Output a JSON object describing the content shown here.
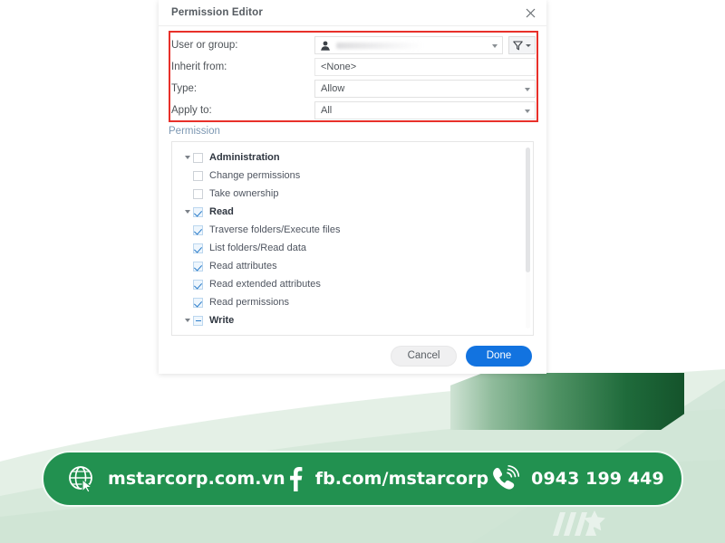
{
  "dialog": {
    "title": "Permission Editor",
    "close_icon": "close-icon",
    "form": {
      "user_label": "User or group:",
      "user_value": "",
      "user_icon": "user-icon",
      "filter_icon": "filter-icon",
      "inherit_label": "Inherit from:",
      "inherit_value": "<None>",
      "type_label": "Type:",
      "type_value": "Allow",
      "apply_label": "Apply to:",
      "apply_value": "All"
    },
    "permission": {
      "section_label": "Permission",
      "rows": [
        {
          "label": "Administration",
          "state": "unchecked",
          "group": true,
          "child": false,
          "twisty": "down"
        },
        {
          "label": "Change permissions",
          "state": "unchecked",
          "group": false,
          "child": true,
          "twisty": "none"
        },
        {
          "label": "Take ownership",
          "state": "unchecked",
          "group": false,
          "child": true,
          "twisty": "none"
        },
        {
          "label": "Read",
          "state": "checked",
          "group": true,
          "child": false,
          "twisty": "down"
        },
        {
          "label": "Traverse folders/Execute files",
          "state": "checked",
          "group": false,
          "child": true,
          "twisty": "none"
        },
        {
          "label": "List folders/Read data",
          "state": "checked",
          "group": false,
          "child": true,
          "twisty": "none"
        },
        {
          "label": "Read attributes",
          "state": "checked",
          "group": false,
          "child": true,
          "twisty": "none"
        },
        {
          "label": "Read extended attributes",
          "state": "checked",
          "group": false,
          "child": true,
          "twisty": "none"
        },
        {
          "label": "Read permissions",
          "state": "checked",
          "group": false,
          "child": true,
          "twisty": "none"
        },
        {
          "label": "Write",
          "state": "indeterminate",
          "group": true,
          "child": false,
          "twisty": "down"
        }
      ]
    },
    "footer": {
      "cancel_label": "Cancel",
      "done_label": "Done"
    }
  },
  "banner": {
    "website": "mstarcorp.com.vn",
    "facebook": "fb.com/mstarcorp",
    "phone": "0943 199 449",
    "globe_icon": "globe-cursor-icon",
    "facebook_icon": "facebook-icon",
    "phone_icon": "phone-ringing-icon",
    "bg_color": "#229150"
  },
  "colors": {
    "accent_blue": "#1273e0",
    "highlight_red": "#e8302a",
    "brand_green": "#229150",
    "ribbon_green": "#14532b"
  }
}
